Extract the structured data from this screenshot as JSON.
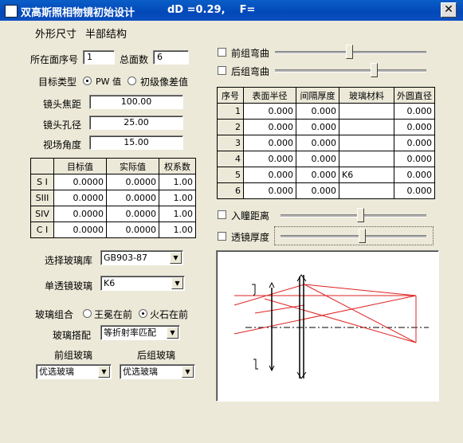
{
  "window": {
    "title": "双高斯照相物镜初始设计",
    "status": "dD =0.29,    F=",
    "close_glyph": "✕"
  },
  "menu": {
    "item1": "外形尺寸",
    "item2": "半部结构"
  },
  "surface_index_label": "所在面序号",
  "surface_index_value": "1",
  "total_surfaces_label": "总面数",
  "total_surfaces_value": "6",
  "target_type": {
    "label": "目标类型",
    "opt1": "PW 值",
    "opt2": "初级像差值",
    "selected": "opt1"
  },
  "focal": {
    "label": "镜头焦距",
    "value": "100.00"
  },
  "aperture": {
    "label": "镜头孔径",
    "value": "25.00"
  },
  "field": {
    "label": "视场角度",
    "value": "15.00"
  },
  "aberr_table": {
    "headers": [
      "",
      "目标值",
      "实际值",
      "权系数"
    ],
    "rows": [
      [
        "S I",
        "0.0000",
        "0.0000",
        "1.00"
      ],
      [
        "SIII",
        "0.0000",
        "0.0000",
        "1.00"
      ],
      [
        "SIV",
        "0.0000",
        "0.0000",
        "1.00"
      ],
      [
        "C I",
        "0.0000",
        "0.0000",
        "1.00"
      ]
    ]
  },
  "glass_lib": {
    "label": "选择玻璃库",
    "value": "GB903-87"
  },
  "single_glass": {
    "label": "单透镜玻璃",
    "value": "K6"
  },
  "glass_combo": {
    "label": "玻璃组合",
    "opt1": "王冕在前",
    "opt2": "火石在前",
    "selected": "opt2"
  },
  "glass_match": {
    "label": "玻璃搭配",
    "value": "等折射率匹配"
  },
  "front_glass": {
    "label": "前组玻璃",
    "value": "优选玻璃"
  },
  "rear_glass": {
    "label": "后组玻璃",
    "value": "优选玻璃"
  },
  "front_bend": {
    "label": "前组弯曲",
    "position": 0.55
  },
  "rear_bend": {
    "label": "后组弯曲",
    "position": 0.65
  },
  "pupil_dist": {
    "label": "入瞳距离",
    "position": 0.55
  },
  "thickness": {
    "label": "透镜厚度",
    "position": 0.42
  },
  "surface_table": {
    "headers": [
      "序号",
      "表面半径",
      "间隔厚度",
      "玻璃材料",
      "外圆直径"
    ],
    "rows": [
      [
        "1",
        "0.000",
        "0.000",
        "",
        "0.000"
      ],
      [
        "2",
        "0.000",
        "0.000",
        "",
        "0.000"
      ],
      [
        "3",
        "0.000",
        "0.000",
        "",
        "0.000"
      ],
      [
        "4",
        "0.000",
        "0.000",
        "",
        "0.000"
      ],
      [
        "5",
        "0.000",
        "0.000",
        "K6",
        "0.000"
      ],
      [
        "6",
        "0.000",
        "0.000",
        "",
        "0.000"
      ]
    ]
  },
  "colors": {
    "titlebar": "#0348b8",
    "ray": "#e02020",
    "axis": "#000000"
  }
}
